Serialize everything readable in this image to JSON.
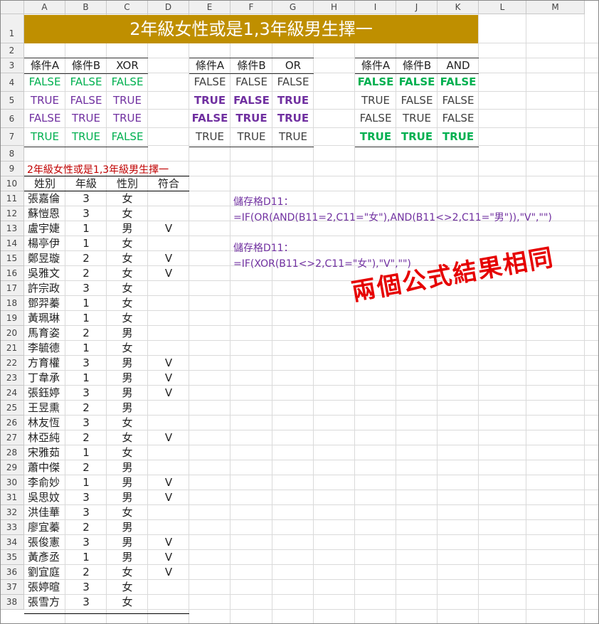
{
  "columns": [
    "A",
    "B",
    "C",
    "D",
    "E",
    "F",
    "G",
    "H",
    "I",
    "J",
    "K",
    "L",
    "M"
  ],
  "rows": [
    "1",
    "2",
    "3",
    "4",
    "5",
    "6",
    "7",
    "8",
    "9",
    "10",
    "11",
    "12",
    "13",
    "14",
    "15",
    "16",
    "17",
    "18",
    "19",
    "20",
    "21",
    "22",
    "23",
    "24",
    "25",
    "26",
    "27",
    "28",
    "29",
    "30",
    "31",
    "32",
    "33",
    "34",
    "35",
    "36",
    "37",
    "38"
  ],
  "title": "2年級女性或是1,3年級男生擇一",
  "colors": {
    "title_bg": "#bf8f00",
    "green": "#00b050",
    "purple": "#7030a0",
    "gray": "#404040",
    "red": "#e60000",
    "dark_red": "#c00000"
  },
  "tables": [
    {
      "headers": [
        "條件A",
        "條件B",
        "XOR"
      ],
      "rows": [
        {
          "values": [
            "FALSE",
            "FALSE",
            "FALSE"
          ],
          "style": "green"
        },
        {
          "values": [
            "TRUE",
            "FALSE",
            "TRUE"
          ],
          "style": "purple"
        },
        {
          "values": [
            "FALSE",
            "TRUE",
            "TRUE"
          ],
          "style": "purple"
        },
        {
          "values": [
            "TRUE",
            "TRUE",
            "FALSE"
          ],
          "style": "green"
        }
      ]
    },
    {
      "headers": [
        "條件A",
        "條件B",
        "OR"
      ],
      "rows": [
        {
          "values": [
            "FALSE",
            "FALSE",
            "FALSE"
          ],
          "style": "gray"
        },
        {
          "values": [
            "TRUE",
            "FALSE",
            "TRUE"
          ],
          "style": "purple-bold"
        },
        {
          "values": [
            "FALSE",
            "TRUE",
            "TRUE"
          ],
          "style": "purple-bold"
        },
        {
          "values": [
            "TRUE",
            "TRUE",
            "TRUE"
          ],
          "style": "gray"
        }
      ]
    },
    {
      "headers": [
        "條件A",
        "條件B",
        "AND"
      ],
      "rows": [
        {
          "values": [
            "FALSE",
            "FALSE",
            "FALSE"
          ],
          "style": "green-bold"
        },
        {
          "values": [
            "TRUE",
            "FALSE",
            "FALSE"
          ],
          "style": "gray"
        },
        {
          "values": [
            "FALSE",
            "TRUE",
            "FALSE"
          ],
          "style": "gray"
        },
        {
          "values": [
            "TRUE",
            "TRUE",
            "TRUE"
          ],
          "style": "green-bold"
        }
      ]
    }
  ],
  "data_title": "2年級女性或是1,3年級男生擇一",
  "data_headers": [
    "姓別",
    "年級",
    "性別",
    "符合"
  ],
  "people": [
    [
      "張嘉倫",
      "3",
      "女",
      ""
    ],
    [
      "蘇愷恩",
      "3",
      "女",
      ""
    ],
    [
      "盧宇婕",
      "1",
      "男",
      "V"
    ],
    [
      "楊亭伊",
      "1",
      "女",
      ""
    ],
    [
      "鄭昱璇",
      "2",
      "女",
      "V"
    ],
    [
      "吳雅文",
      "2",
      "女",
      "V"
    ],
    [
      "許宗政",
      "3",
      "女",
      ""
    ],
    [
      "鄧羿蓁",
      "1",
      "女",
      ""
    ],
    [
      "黃珮琳",
      "1",
      "女",
      ""
    ],
    [
      "馬育姿",
      "2",
      "男",
      ""
    ],
    [
      "李毓德",
      "1",
      "女",
      ""
    ],
    [
      "方育權",
      "3",
      "男",
      "V"
    ],
    [
      "丁韋承",
      "1",
      "男",
      "V"
    ],
    [
      "張鈺婷",
      "3",
      "男",
      "V"
    ],
    [
      "王昱熏",
      "2",
      "男",
      ""
    ],
    [
      "林友恆",
      "3",
      "女",
      ""
    ],
    [
      "林亞純",
      "2",
      "女",
      "V"
    ],
    [
      "宋雅茹",
      "1",
      "女",
      ""
    ],
    [
      "蕭中傑",
      "2",
      "男",
      ""
    ],
    [
      "李俞妙",
      "1",
      "男",
      "V"
    ],
    [
      "吳思妏",
      "3",
      "男",
      "V"
    ],
    [
      "洪佳華",
      "3",
      "女",
      ""
    ],
    [
      "廖宜蓁",
      "2",
      "男",
      ""
    ],
    [
      "張俊憲",
      "3",
      "男",
      "V"
    ],
    [
      "黃彥丞",
      "1",
      "男",
      "V"
    ],
    [
      "劉宜庭",
      "2",
      "女",
      "V"
    ],
    [
      "張婷暄",
      "3",
      "女",
      ""
    ],
    [
      "張雪方",
      "3",
      "女",
      ""
    ]
  ],
  "formulas": {
    "label1": "儲存格D11：",
    "formula1": "=IF(OR(AND(B11=2,C11=\"女\"),AND(B11<>2,C11=\"男\")),\"V\",\"\")",
    "label2": "儲存格D11：",
    "formula2": "=IF(XOR(B11<>2,C11=\"女\"),\"V\",\"\")"
  },
  "stamp": "兩個公式結果相同"
}
